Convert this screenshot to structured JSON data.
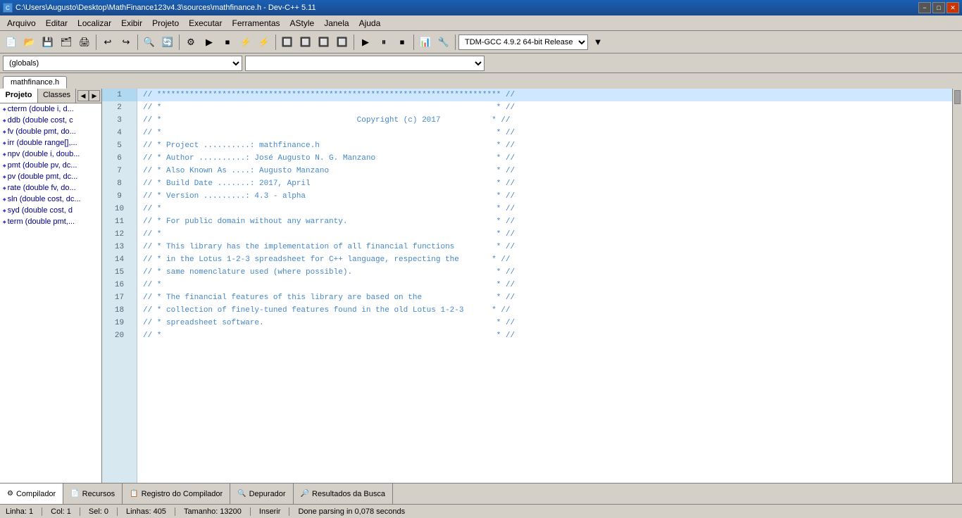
{
  "titlebar": {
    "title": "C:\\Users\\Augusto\\Desktop\\MathFinance123v4.3\\sources\\mathfinance.h - Dev-C++ 5.11",
    "icon": "C",
    "min_label": "−",
    "max_label": "□",
    "close_label": "✕"
  },
  "menubar": {
    "items": [
      {
        "label": "Arquivo"
      },
      {
        "label": "Editar"
      },
      {
        "label": "Localizar"
      },
      {
        "label": "Exibir"
      },
      {
        "label": "Projeto"
      },
      {
        "label": "Executar"
      },
      {
        "label": "Ferramentas"
      },
      {
        "label": "AStyle"
      },
      {
        "label": "Janela"
      },
      {
        "label": "Ajuda"
      }
    ]
  },
  "toolbar": {
    "dropdown1": {
      "value": "TDM-GCC 4.9.2 64-bit Release"
    }
  },
  "toolbar2": {
    "dropdown1": {
      "value": "(globals)"
    },
    "dropdown2": {
      "value": ""
    }
  },
  "tabs": {
    "items": [
      {
        "label": "Projeto"
      },
      {
        "label": "Classes"
      }
    ],
    "active": 0
  },
  "editor_tab": {
    "label": "mathfinance.h"
  },
  "sidebar": {
    "items": [
      {
        "label": "cterm (double i, d..."
      },
      {
        "label": "ddb (double cost, c"
      },
      {
        "label": "fv (double pmt, do..."
      },
      {
        "label": "irr (double range[],..."
      },
      {
        "label": "npv (double i, doub..."
      },
      {
        "label": "pmt (double pv, dc..."
      },
      {
        "label": "pv (double pmt, dc..."
      },
      {
        "label": "rate (double fv, do..."
      },
      {
        "label": "sln (double cost, dc..."
      },
      {
        "label": "syd (double cost, d"
      },
      {
        "label": "term (double pmt,..."
      }
    ]
  },
  "code": {
    "lines": [
      {
        "num": 1,
        "text": "// ************************************************************************** //",
        "highlight": true
      },
      {
        "num": 2,
        "text": "// *                                                                        * //",
        "highlight": false
      },
      {
        "num": 3,
        "text": "// *                                          Copyright (c) 2017           * //",
        "highlight": false
      },
      {
        "num": 4,
        "text": "// *                                                                        * //",
        "highlight": false
      },
      {
        "num": 5,
        "text": "// * Project ..........: mathfinance.h                                      * //",
        "highlight": false
      },
      {
        "num": 6,
        "text": "// * Author ..........: José Augusto N. G. Manzano                          * //",
        "highlight": false
      },
      {
        "num": 7,
        "text": "// * Also Known As ....: Augusto Manzano                                    * //",
        "highlight": false
      },
      {
        "num": 8,
        "text": "// * Build Date .......: 2017, April                                        * //",
        "highlight": false
      },
      {
        "num": 9,
        "text": "// * Version .........: 4.3 - alpha                                         * //",
        "highlight": false
      },
      {
        "num": 10,
        "text": "// *                                                                        * //",
        "highlight": false
      },
      {
        "num": 11,
        "text": "// * For public domain without any warranty.                                * //",
        "highlight": false
      },
      {
        "num": 12,
        "text": "// *                                                                        * //",
        "highlight": false
      },
      {
        "num": 13,
        "text": "// * This library has the implementation of all financial functions         * //",
        "highlight": false
      },
      {
        "num": 14,
        "text": "// * in the Lotus 1-2-3 spreadsheet for C++ language, respecting the       * //",
        "highlight": false
      },
      {
        "num": 15,
        "text": "// * same nomenclature used (where possible).                               * //",
        "highlight": false
      },
      {
        "num": 16,
        "text": "// *                                                                        * //",
        "highlight": false
      },
      {
        "num": 17,
        "text": "// * The financial features of this library are based on the                * //",
        "highlight": false
      },
      {
        "num": 18,
        "text": "// * collection of finely-tuned features found in the old Lotus 1-2-3      * //",
        "highlight": false
      },
      {
        "num": 19,
        "text": "// * spreadsheet software.                                                  * //",
        "highlight": false
      },
      {
        "num": 20,
        "text": "// *                                                                        * //",
        "highlight": false
      }
    ]
  },
  "bottom_tabs": [
    {
      "label": "Compilador",
      "icon": "⚙"
    },
    {
      "label": "Recursos",
      "icon": "📄"
    },
    {
      "label": "Registro do Compilador",
      "icon": "📋"
    },
    {
      "label": "Depurador",
      "icon": "🔍"
    },
    {
      "label": "Resultados da Busca",
      "icon": "🔎"
    }
  ],
  "status": {
    "line": "Linha:   1",
    "col": "Col:   1",
    "sel": "Sel:   0",
    "lines": "Linhas:   405",
    "size": "Tamanho: 13200",
    "insert": "Inserir",
    "message": "Done parsing in 0,078 seconds"
  }
}
